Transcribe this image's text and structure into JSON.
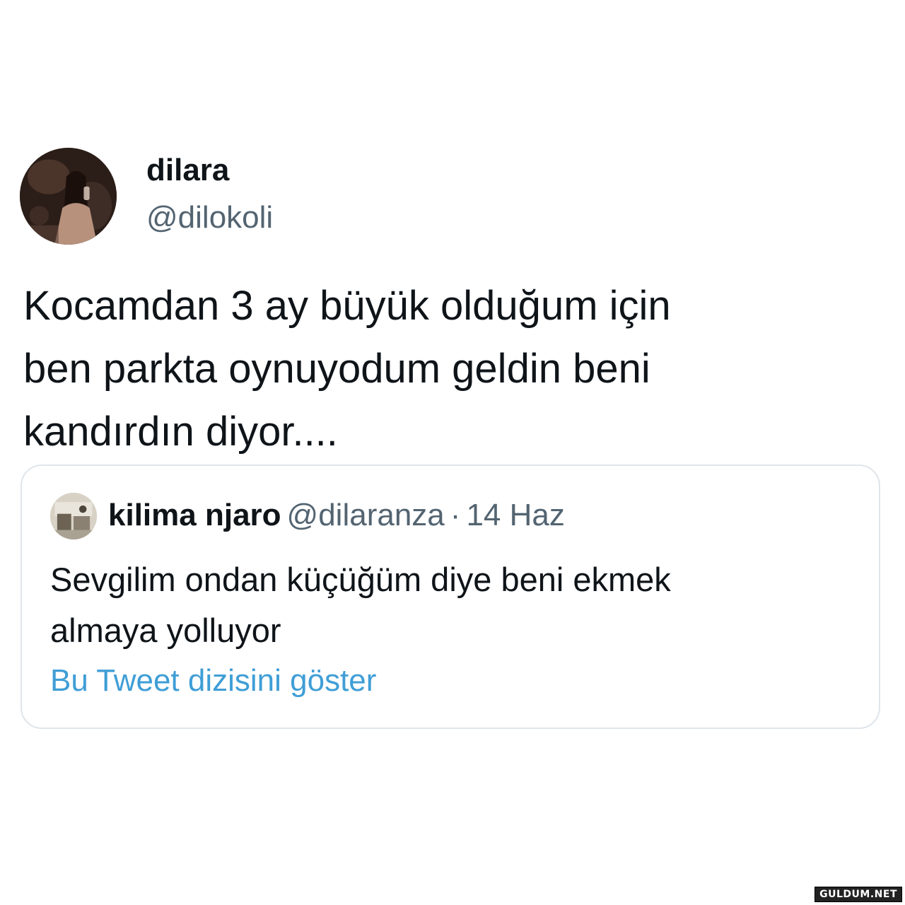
{
  "tweet": {
    "author": {
      "display_name": "dilara",
      "handle": "@dilokoli",
      "avatar_icon": "profile-photo"
    },
    "text_lines": [
      "Kocamdan 3 ay büyük olduğum için",
      "ben parkta oynuyodum geldin beni",
      "kandırdın diyor...."
    ],
    "quoted_tweet": {
      "author": {
        "display_name": "kilima njaro",
        "handle": "@dilaranza",
        "separator": "·",
        "date": "14 Haz",
        "avatar_icon": "profile-photo"
      },
      "text_lines": [
        "Sevgilim ondan küçüğüm diye beni ekmek",
        "almaya yolluyor"
      ],
      "show_thread_label": "Bu Tweet dizisini göster"
    }
  },
  "watermark": "GULDUM.NET",
  "colors": {
    "text_primary": "#0f1419",
    "text_secondary": "#536471",
    "link": "#3f9ed6",
    "card_border": "#dfe5ea",
    "background": "#ffffff"
  }
}
